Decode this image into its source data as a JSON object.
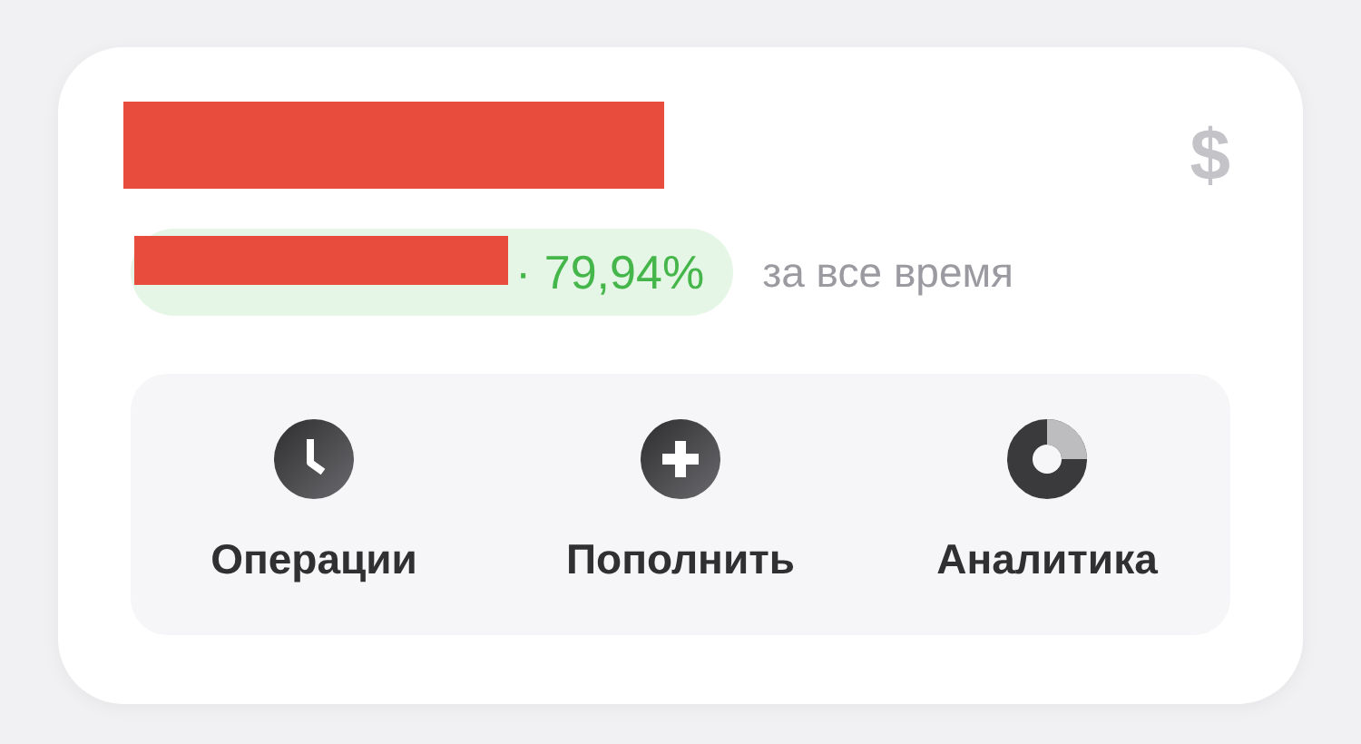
{
  "balance": {
    "redacted": true,
    "currency_symbol": "$"
  },
  "change": {
    "redacted": true,
    "percent": "· 79,94%",
    "period": "за все время"
  },
  "actions": [
    {
      "kind": "clock",
      "label": "Операции"
    },
    {
      "kind": "plus",
      "label": "Пополнить"
    },
    {
      "kind": "donut",
      "label": "Аналитика"
    }
  ]
}
